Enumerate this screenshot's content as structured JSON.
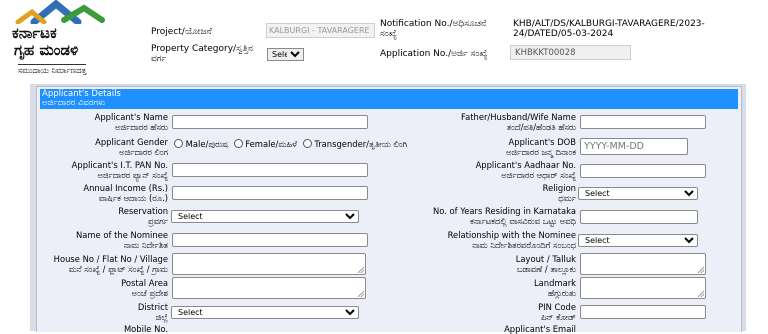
{
  "header": {
    "logo_line1": "ಕರ್ನಾಟಕ",
    "logo_line2": "ಗೃಹ ಮಂಡಳಿ",
    "logo_tagline": "ಸಮುದಾಯ ನಿರ್ಮಾಣದತ್ತ",
    "project_label": "Project/ಯೋಜನೆ",
    "project_value": "KALBURGI - TAVARAGERE",
    "property_category_label_1": "Property Category/ಸ್ವತ್ತಿನ",
    "property_category_label_2": "ವರ್ಗ",
    "property_category_value": "Select",
    "notification_label_1": "Notification No./ಅಧಿಸೂಚನೆ",
    "notification_label_2": "ಸಂಖ್ಯೆ",
    "notification_value": "KHB/ALT/DS/KALBURGI-TAVARAGERE/2023-24/DATED/05-03-2024",
    "application_label": "Application No./ಅರ್ಜಿ ಸಂಖ್ಯೆ",
    "application_value": "KHBKKT00028"
  },
  "section": {
    "title": "Applicant's Details",
    "title_kn": "ಅರ್ಜಿದಾರರ ವಿವರಗಳು"
  },
  "form": {
    "applicant_name": {
      "en": "Applicant's Name",
      "kn": "ಅರ್ಜಿದಾರರ ಹೆಸರು"
    },
    "father_name": {
      "en": "Father/Husband/Wife Name",
      "kn": "ತಂದೆ/ಪತಿ/ಹೆಂಡತಿ ಹೆಸರು"
    },
    "gender": {
      "en": "Applicant Gender",
      "kn": "ಅರ್ಜಿದಾರರ ಲಿಂಗ",
      "male": "Male/ಪುರುಷ",
      "female": "Female/ಮಹಿಳೆ",
      "trans": "Transgender/ತೃತೀಯ ಲಿಂಗಿ"
    },
    "dob": {
      "en": "Applicant's DOB",
      "kn": "ಅರ್ಜಿದಾರರ ಜನ್ಮ ದಿನಾಂಕ",
      "placeholder": "YYYY-MM-DD"
    },
    "pan": {
      "en": "Applicant's I.T. PAN No.",
      "kn": "ಅರ್ಜಿದಾರರ ಪ್ಯಾನ್ ಸಂಖ್ಯೆ"
    },
    "aadhaar": {
      "en": "Applicant's Aadhaar No.",
      "kn": "ಅರ್ಜಿದಾರರ ಆಧಾರ್ ಸಂಖ್ಯೆ"
    },
    "income": {
      "en": "Annual Income (Rs.)",
      "kn": "ವಾರ್ಷಿಕ ಆದಾಯ (ರೂ.)"
    },
    "religion": {
      "en": "Religion",
      "kn": "ಧರ್ಮ",
      "value": "Select"
    },
    "reservation": {
      "en": "Reservation",
      "kn": "ಪ್ರವರ್ಗ",
      "value": "Select"
    },
    "years_karnataka": {
      "en": "No. of Years Residing in Karnataka",
      "kn": "ಕರ್ನಾಟಕದಲ್ಲಿ ವಾಸವಿರುವ ಒಟ್ಟು ಅವಧಿ"
    },
    "nominee": {
      "en": "Name of the Nominee",
      "kn": "ನಾಮ ನಿರ್ದೇಶಿತ"
    },
    "nominee_relation": {
      "en": "Relationship with the Nominee",
      "kn": "ನಾಮ ನಿರ್ದೇಶಿತರವರೊಂದಿಗೆ ಸಂಬಂಧ",
      "value": "Select"
    },
    "house": {
      "en": "House No / Flat No / Village",
      "kn": "ಮನೆ ಸಂಖ್ಯೆ / ಫ್ಲಾಟ್ ಸಂಖ್ಯೆ / ಗ್ರಾಮ"
    },
    "layout": {
      "en": "Layout / Talluk",
      "kn": "ಬಡಾವಣೆ / ತಾಲ್ಲೂಕು"
    },
    "postal": {
      "en": "Postal Area",
      "kn": "ಅಂಚೆ ಪ್ರದೇಶ"
    },
    "landmark": {
      "en": "Landmark",
      "kn": "ಹೆಗ್ಗುರುತು"
    },
    "district": {
      "en": "District",
      "kn": "ಜಿಲ್ಲೆ",
      "value": "Select"
    },
    "pin": {
      "en": "PIN Code",
      "kn": "ಪಿನ್ ಕೋಡ್"
    },
    "mobile": {
      "en": "Mobile No."
    },
    "email": {
      "en": "Applicant's Email"
    }
  },
  "colors": {
    "section_bar": "#1e90ff",
    "panel_bg": "#eceef8",
    "outer_bg": "#d8dbe8"
  }
}
